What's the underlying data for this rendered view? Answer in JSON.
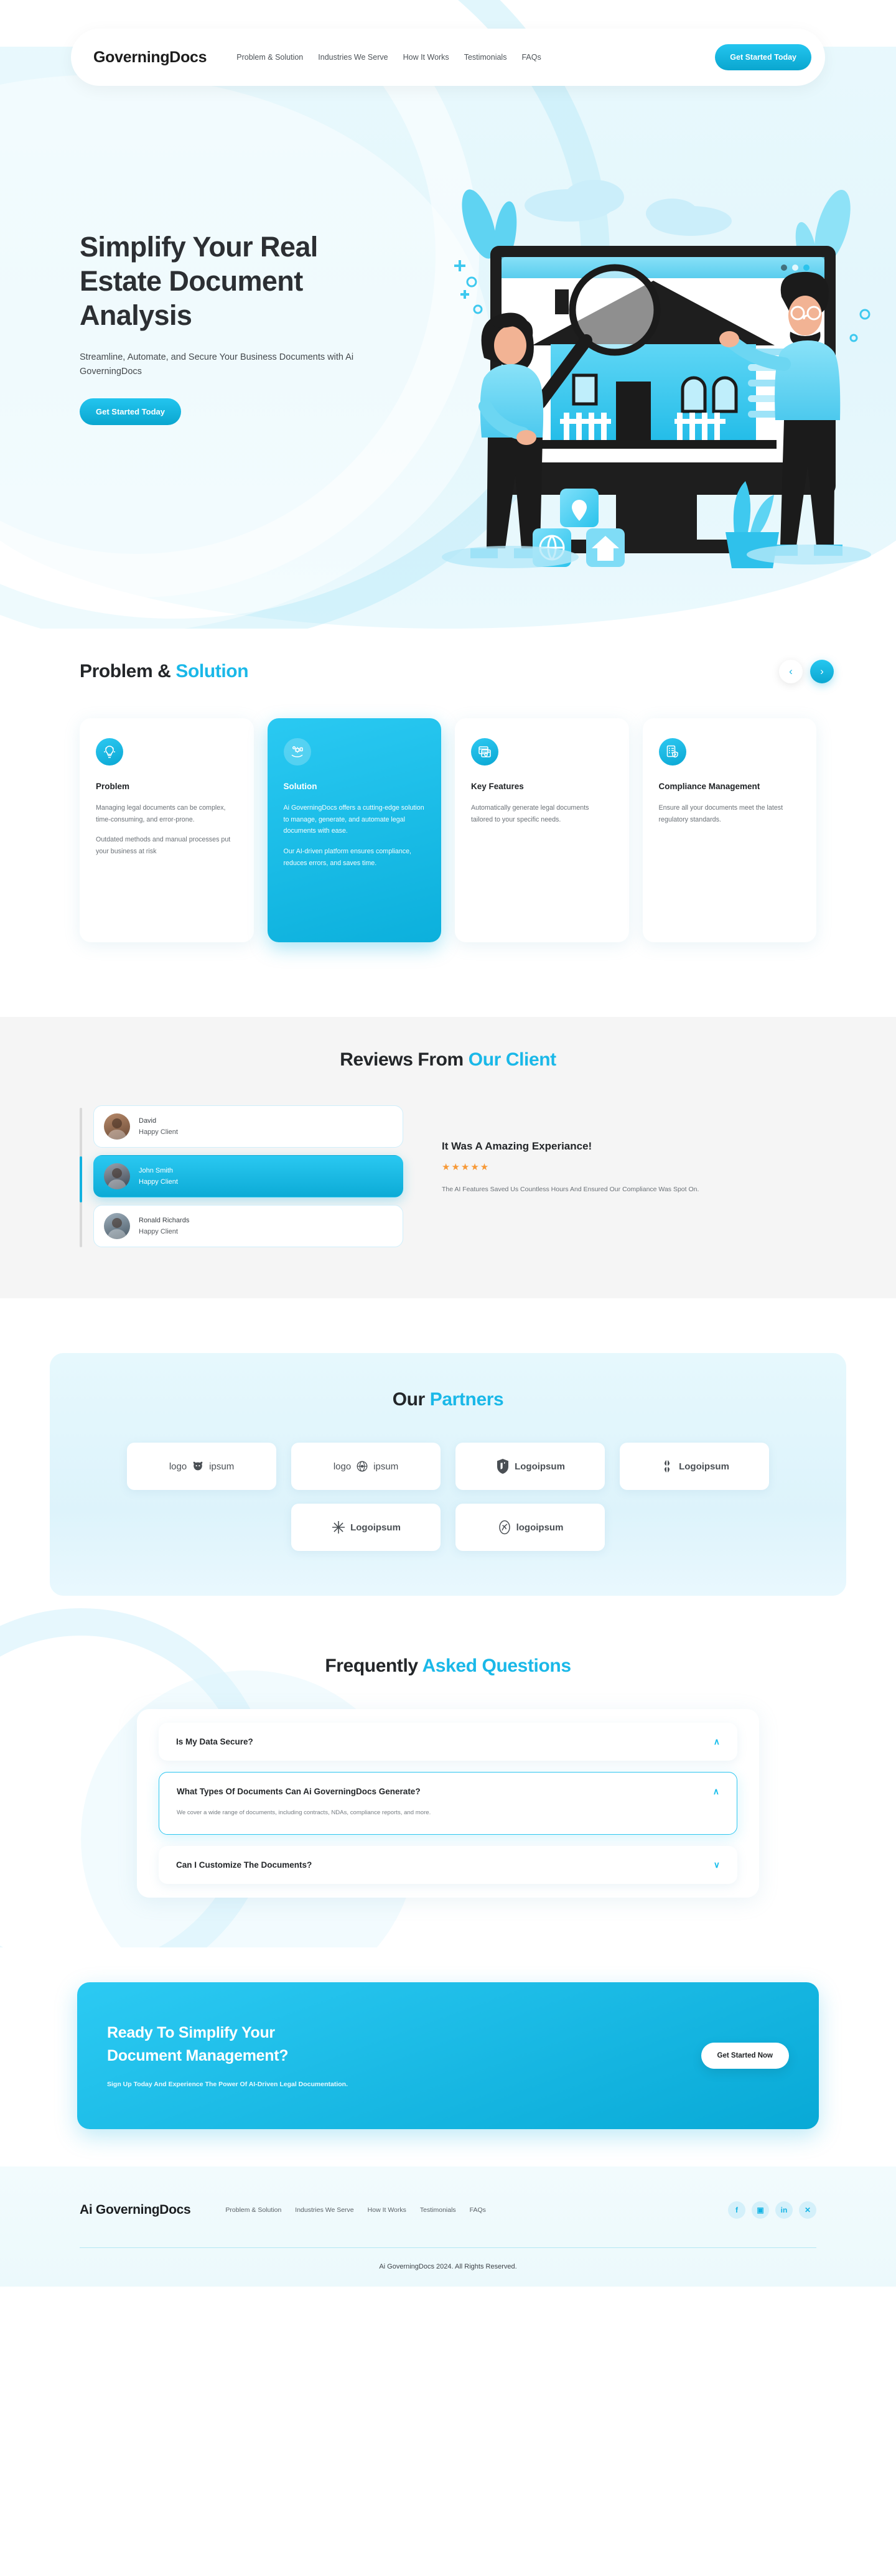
{
  "colors": {
    "accent": "#1ab8e8",
    "accent_dark": "#0aa6cf",
    "star": "#f79937",
    "heading": "#232629",
    "body": "#6b7177"
  },
  "nav": {
    "brand": "GoverningDocs",
    "links": [
      "Problem & Solution",
      "Industries We Serve",
      "How It Works",
      "Testimonials",
      "FAQs"
    ],
    "cta_label": "Get Started Today"
  },
  "hero": {
    "title": "Simplify Your Real Estate Document Analysis",
    "subtitle": "Streamline, Automate, and Secure Your Business Documents with Ai GoverningDocs",
    "cta_label": "Get Started Today",
    "illustration_name": "real-estate-document-analysis-illustration"
  },
  "problem_solution": {
    "title_plain": "Problem & ",
    "title_accent": "Solution",
    "prev_label": "‹",
    "next_label": "›",
    "cards": [
      {
        "icon": "lightbulb-idea-icon",
        "title": "Problem",
        "paragraphs": [
          "Managing legal documents can be complex, time-consuming, and error-prone.",
          "Outdated methods and manual processes put your business at risk"
        ],
        "highlight": false
      },
      {
        "icon": "hand-gear-solution-icon",
        "title": "Solution",
        "paragraphs": [
          "Ai GoverningDocs offers a cutting-edge solution to manage, generate, and automate legal documents with ease.",
          "Our AI-driven platform ensures compliance, reduces errors, and saves time."
        ],
        "highlight": true
      },
      {
        "icon": "window-gear-icon",
        "title": "Key Features",
        "paragraphs": [
          "Automatically generate legal documents tailored to your specific needs."
        ],
        "highlight": false
      },
      {
        "icon": "checklist-shield-icon",
        "title": "Compliance Management",
        "paragraphs": [
          "Ensure all your documents meet the latest regulatory standards."
        ],
        "highlight": false
      }
    ]
  },
  "reviews": {
    "title_plain": "Reviews From ",
    "title_accent": "Our Client",
    "list": [
      {
        "name": "David",
        "role": "Happy Client",
        "active": false
      },
      {
        "name": "John Smith",
        "role": "Happy Client",
        "active": true
      },
      {
        "name": "Ronald Richards",
        "role": "Happy Client",
        "active": false
      }
    ],
    "detail": {
      "heading": "It Was A Amazing Experiance!",
      "stars": "★★★★★",
      "rating": 5,
      "body": "The AI Features Saved Us Countless Hours And Ensured Our Compliance Was Spot On."
    }
  },
  "partners": {
    "title_plain": "Our ",
    "title_accent": "Partners",
    "logos": [
      {
        "mark": "bear-logo-mark",
        "pre": "logo",
        "post": "ipsum",
        "style": "light"
      },
      {
        "mark": "globe-logo-mark",
        "pre": "logo",
        "post": "ipsum",
        "style": "light"
      },
      {
        "mark": "shield-logo-mark",
        "pre": "",
        "post": "Logoipsum",
        "style": "bold"
      },
      {
        "mark": "clover-logo-mark",
        "pre": "",
        "post": "Logoipsum",
        "style": "bold"
      },
      {
        "mark": "asterisk-logo-mark",
        "pre": "",
        "post": "Logoipsum",
        "style": "bold"
      },
      {
        "mark": "leaf-circle-logo-mark",
        "pre": "",
        "post": "logoipsum",
        "style": "bold"
      }
    ]
  },
  "faq": {
    "title_plain": "Frequently ",
    "title_accent": "Asked Questions",
    "items": [
      {
        "question": "Is My Data Secure?",
        "answer": "",
        "open": false,
        "chevron": "∧"
      },
      {
        "question": "What Types Of Documents Can Ai GoverningDocs Generate?",
        "answer": "We cover a wide range of documents, including contracts, NDAs, compliance reports, and more.",
        "open": true,
        "chevron": "∧"
      },
      {
        "question": "Can I Customize The Documents?",
        "answer": "",
        "open": false,
        "chevron": "∨"
      }
    ]
  },
  "cta": {
    "heading_line1": "Ready To Simplify Your",
    "heading_line2": "Document Management?",
    "sub": "Sign Up Today And Experience The Power Of AI-Driven Legal Documentation.",
    "button_label": "Get Started Now"
  },
  "footer": {
    "brand": "Ai GoverningDocs",
    "links": [
      "Problem & Solution",
      "Industries We Serve",
      "How It Works",
      "Testimonials",
      "FAQs"
    ],
    "socials": [
      {
        "name": "facebook-icon",
        "glyph": "f"
      },
      {
        "name": "instagram-icon",
        "glyph": "▣"
      },
      {
        "name": "linkedin-icon",
        "glyph": "in"
      },
      {
        "name": "x-twitter-icon",
        "glyph": "✕"
      }
    ],
    "copyright": "Ai GoverningDocs 2024. All Rights Reserved."
  }
}
